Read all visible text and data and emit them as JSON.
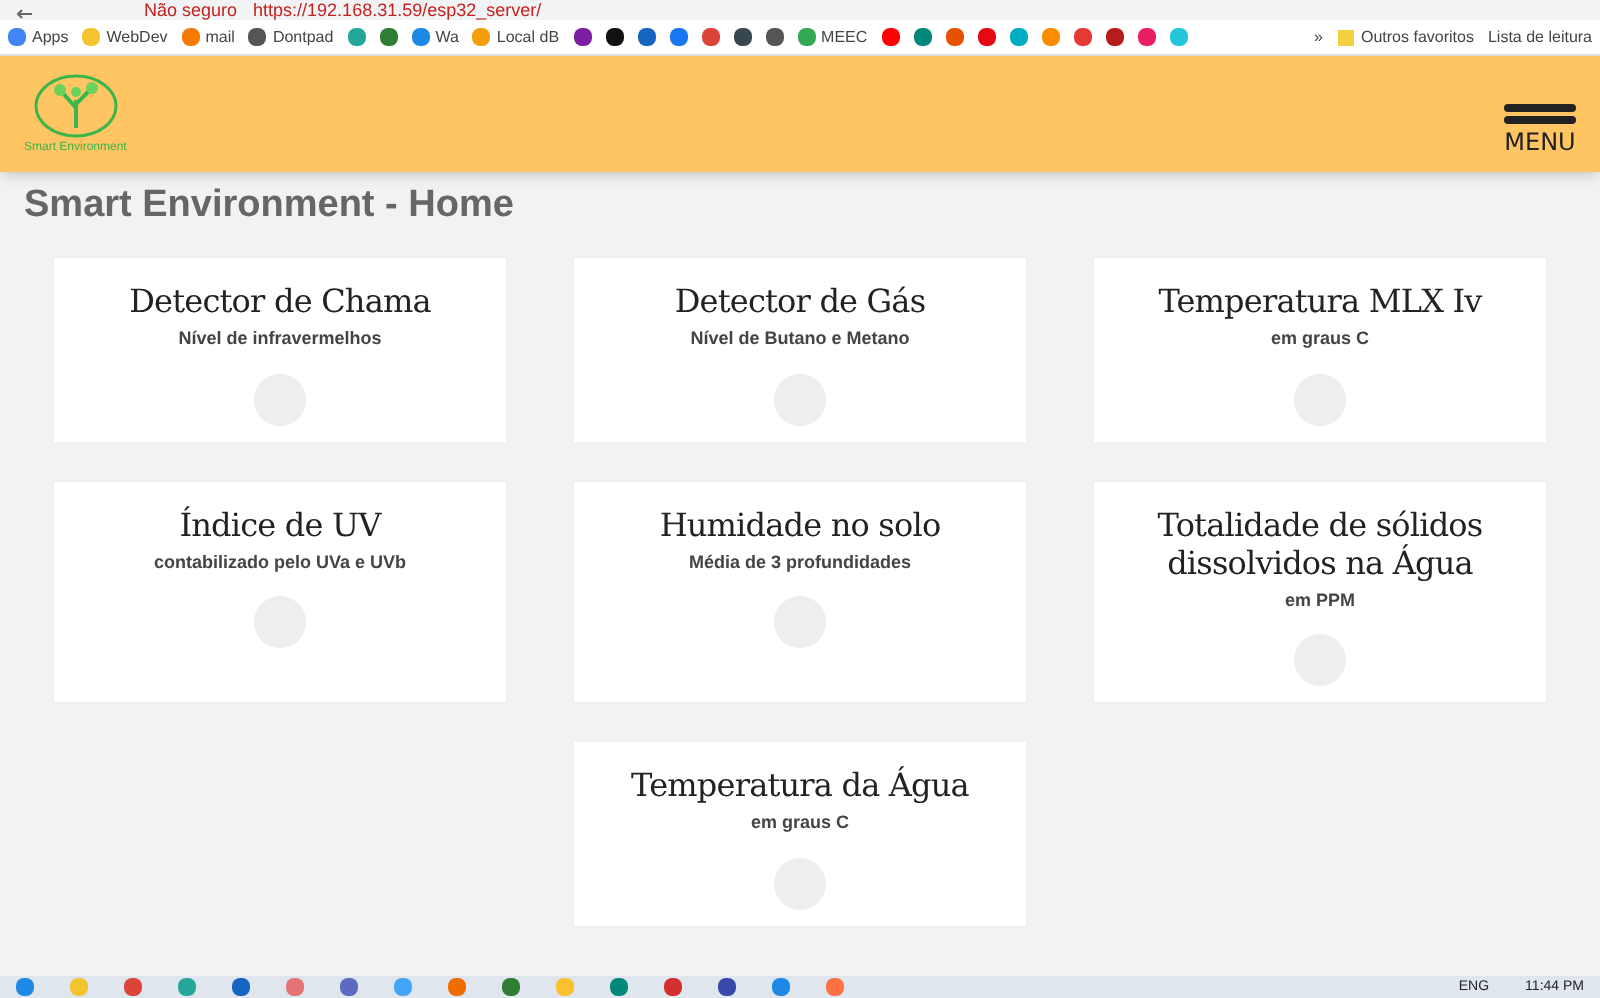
{
  "browser": {
    "security": "Não seguro",
    "url": "https://192.168.31.59/esp32_server/",
    "bookmarks": [
      {
        "label": "Apps",
        "color": "#4285f4"
      },
      {
        "label": "WebDev",
        "color": "#f4c430"
      },
      {
        "label": "mail",
        "color": "#f57c00"
      },
      {
        "label": "Dontpad",
        "color": "#555555"
      },
      {
        "color": "#26a69a"
      },
      {
        "color": "#2e7d32"
      },
      {
        "label": "Wa",
        "color": "#1e88e5"
      },
      {
        "label": "Local dB",
        "color": "#f59e0b"
      },
      {
        "color": "#7b1fa2"
      },
      {
        "color": "#111111"
      },
      {
        "color": "#1565c0"
      },
      {
        "color": "#1877f2"
      },
      {
        "color": "#db4437"
      },
      {
        "color": "#37474f"
      },
      {
        "color": "#555555"
      },
      {
        "label": "MEEC",
        "color": "#34a853"
      },
      {
        "color": "#ff0000"
      },
      {
        "color": "#00897b"
      },
      {
        "color": "#e65100"
      },
      {
        "color": "#e50914"
      },
      {
        "color": "#00acc1"
      },
      {
        "color": "#fb8c00"
      },
      {
        "color": "#e53935"
      },
      {
        "color": "#b71c1c"
      },
      {
        "color": "#e91e63"
      },
      {
        "color": "#26c6da"
      }
    ],
    "overflow": "»",
    "other_bookmarks": "Outros favoritos",
    "reading_list": "Lista de leitura"
  },
  "header": {
    "logo_text": "Smart Environment",
    "menu_label": "MENU"
  },
  "page_title": "Smart Environment - Home",
  "cards": [
    {
      "title": "Detector de Chama",
      "subtitle": "Nível de infravermelhos"
    },
    {
      "title": "Detector de Gás",
      "subtitle": "Nível de Butano e Metano"
    },
    {
      "title": "Temperatura MLX Iv",
      "subtitle": "em graus C"
    },
    {
      "title": "Índice de UV",
      "subtitle": "contabilizado pelo UVa e UVb"
    },
    {
      "title": "Humidade no solo",
      "subtitle": "Média de 3 profundidades"
    },
    {
      "title": "Totalidade de sólidos dissolvidos na Água",
      "subtitle": "em PPM"
    },
    {
      "title": "Temperatura da Água",
      "subtitle": "em graus C"
    }
  ],
  "taskbar": {
    "language": "ENG",
    "time": "11:44 PM",
    "apps": [
      {
        "color": "#1e88e5"
      },
      {
        "color": "#f4c430"
      },
      {
        "color": "#db4437"
      },
      {
        "color": "#26a69a"
      },
      {
        "color": "#1565c0"
      },
      {
        "color": "#e57373"
      },
      {
        "color": "#5c6bc0"
      },
      {
        "color": "#42a5f5"
      },
      {
        "color": "#ef6c00"
      },
      {
        "color": "#2e7d32"
      },
      {
        "color": "#fbc02d"
      },
      {
        "color": "#00897b"
      },
      {
        "color": "#d32f2f"
      },
      {
        "color": "#3949ab"
      },
      {
        "color": "#1e88e5"
      },
      {
        "color": "#ff7043"
      }
    ]
  }
}
